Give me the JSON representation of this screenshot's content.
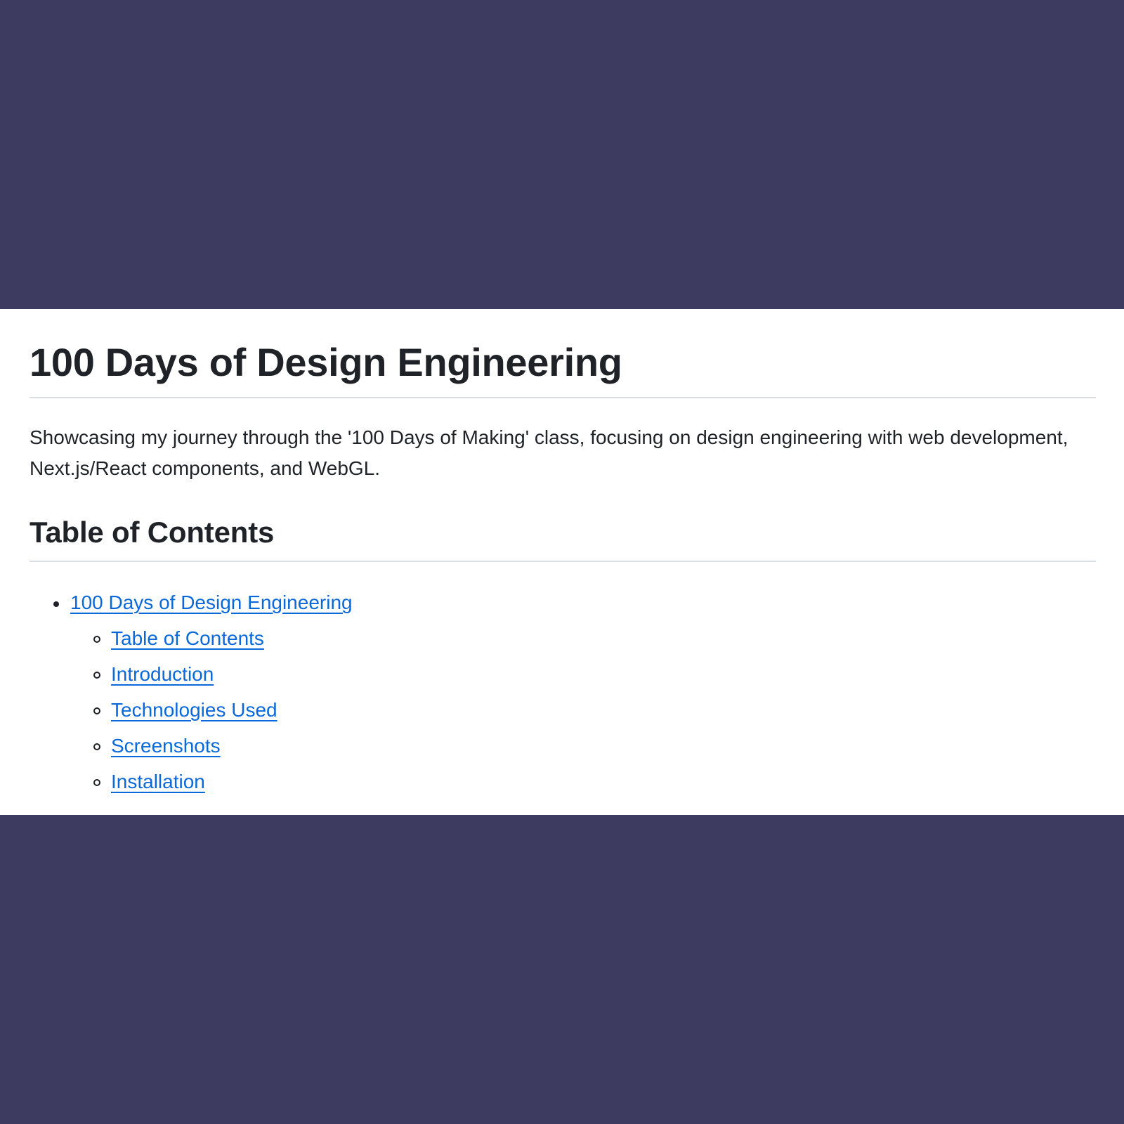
{
  "document": {
    "title": "100 Days of Design Engineering",
    "description": "Showcasing my journey through the '100 Days of Making' class, focusing on design engineering with web development, Next.js/React components, and WebGL.",
    "toc_heading": "Table of Contents",
    "toc": {
      "top_link": "100 Days of Design Engineering",
      "sub_links": [
        "Table of Contents",
        "Introduction",
        "Technologies Used",
        "Screenshots",
        "Installation"
      ]
    }
  },
  "colors": {
    "background": "#3e3b61",
    "panel": "#ffffff",
    "text": "#1f2328",
    "link": "#0969da",
    "rule": "#d8dee4"
  }
}
